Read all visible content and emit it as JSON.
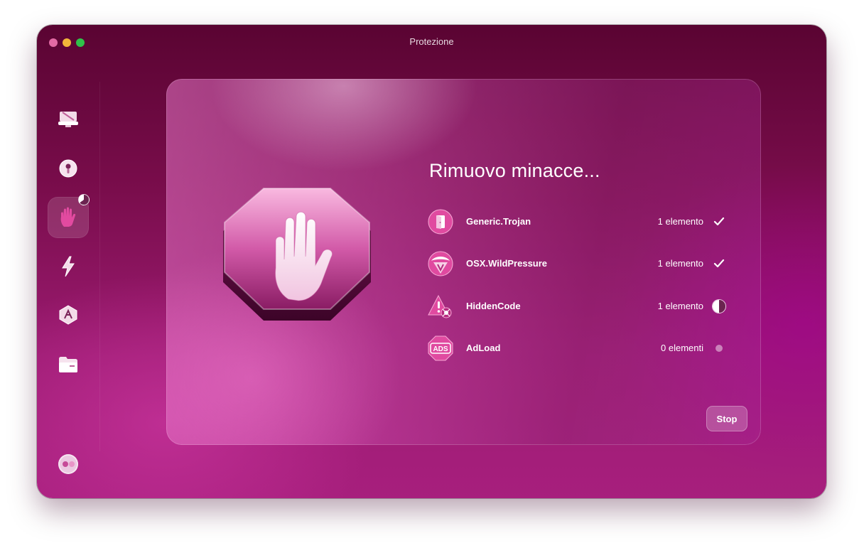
{
  "window": {
    "title": "Protezione"
  },
  "colors": {
    "accent": "#a71f7d",
    "panel_tint": "#d66bb8"
  },
  "sidebar": {
    "items": [
      {
        "icon": "monitor-icon",
        "name": "Smart Care"
      },
      {
        "icon": "disk-icon",
        "name": "Cleanup"
      },
      {
        "icon": "hand-icon",
        "name": "Protection",
        "active": true
      },
      {
        "icon": "bolt-icon",
        "name": "Performance"
      },
      {
        "icon": "apps-icon",
        "name": "Applications"
      },
      {
        "icon": "folder-icon",
        "name": "My Clutter"
      }
    ],
    "assistant_icon": "assistant-icon"
  },
  "main": {
    "heading": "Rimuovo minacce...",
    "hero_icon": "stop-hand-icon",
    "threats": [
      {
        "name": "Generic.Trojan",
        "count": "1 elemento",
        "status": "done",
        "icon": "trojan-door-icon"
      },
      {
        "name": "OSX.WildPressure",
        "count": "1 elemento",
        "status": "done",
        "icon": "malware-v-icon"
      },
      {
        "name": "HiddenCode",
        "count": "1 elemento",
        "status": "in-progress",
        "icon": "hidden-code-warning-icon"
      },
      {
        "name": "AdLoad",
        "count": "0 elementi",
        "status": "pending",
        "icon": "ads-icon",
        "icon_text": "ADS"
      }
    ],
    "stop_label": "Stop"
  }
}
